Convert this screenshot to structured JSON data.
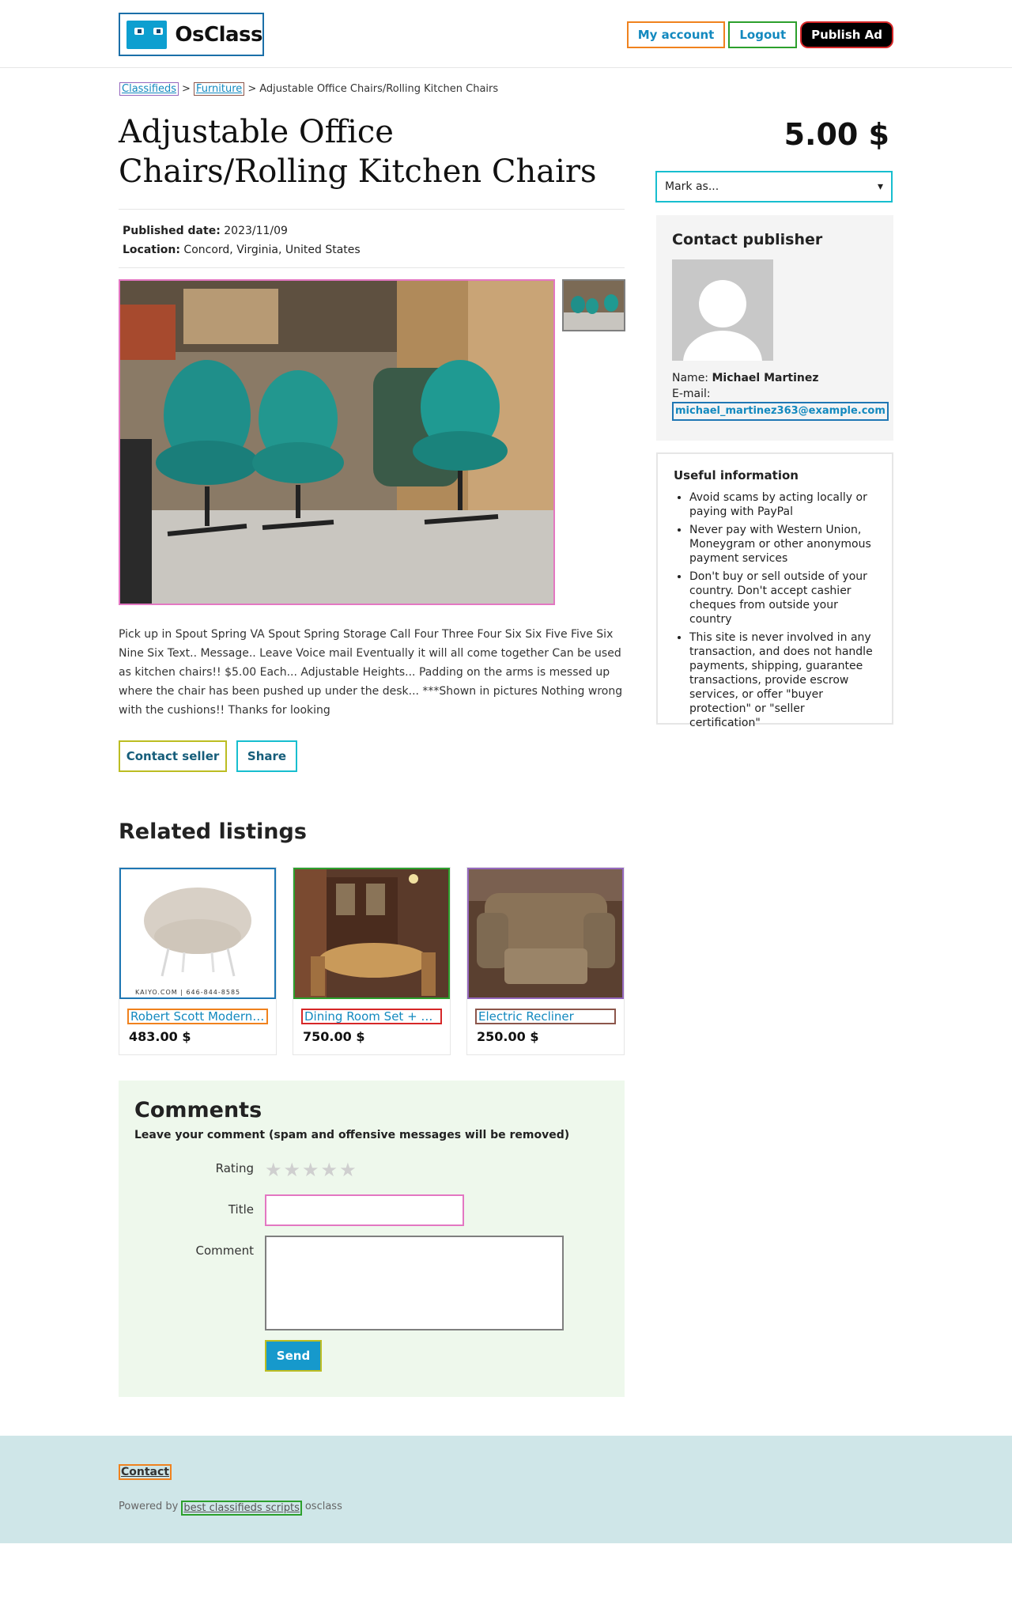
{
  "header": {
    "logo_text": "OsClass",
    "nav": {
      "my_account": "My account",
      "logout": "Logout",
      "publish": "Publish Ad"
    }
  },
  "breadcrumb": {
    "items": [
      "Classifieds",
      "Furniture"
    ],
    "current": "Adjustable Office Chairs/Rolling Kitchen Chairs",
    "separator": ">"
  },
  "listing": {
    "title": "Adjustable Office Chairs/Rolling Kitchen Chairs",
    "price": "5.00 $",
    "published_label": "Published date:",
    "published_value": "2023/11/09",
    "location_label": "Location:",
    "location_value": "Concord, Virginia, United States",
    "description": "Pick up in Spout Spring VA Spout Spring Storage Call Four Three Four Six Six Five Five Six Nine Six Text.. Message.. Leave Voice mail Eventually it will all come together Can be used as kitchen chairs!! $5.00 Each... Adjustable Heights... Padding on the arms is messed up where the chair has been pushed up under the desk... ***Shown in pictures Nothing wrong with the cushions!! Thanks for looking",
    "contact_button": "Contact seller",
    "share_button": "Share"
  },
  "aside": {
    "mark_as": "Mark as...",
    "contact_title": "Contact publisher",
    "name_label": "Name:",
    "name_value": "Michael Martinez",
    "email_label": "E-mail:",
    "email_value": "michael_martinez363@example.com",
    "useful_title": "Useful information",
    "useful_items": [
      "Avoid scams by acting locally or paying with PayPal",
      "Never pay with Western Union, Moneygram or other anonymous payment services",
      "Don't buy or sell outside of your country. Don't accept cashier cheques from outside your country",
      "This site is never involved in any transaction, and does not handle payments, shipping, guarantee transactions, provide escrow services, or offer \"buyer protection\" or \"seller certification\""
    ]
  },
  "related": {
    "title": "Related listings",
    "items": [
      {
        "name": "Robert Scott Modern Chair",
        "price": "483.00 $",
        "watermark": "KAIYO.COM | 646-844-8585"
      },
      {
        "name": "Dining Room Set + Hutch",
        "price": "750.00 $"
      },
      {
        "name": "Electric Recliner",
        "price": "250.00 $"
      }
    ]
  },
  "comments": {
    "title": "Comments",
    "note": "Leave your comment (spam and offensive messages will be removed)",
    "rating_label": "Rating",
    "title_label": "Title",
    "comment_label": "Comment",
    "send": "Send"
  },
  "footer": {
    "contact": "Contact",
    "powered_by": "Powered by",
    "link": "best classifieds scripts",
    "suffix": "osclass"
  },
  "colors": {
    "accent": "#1389bf",
    "send": "#1699cc",
    "comments_bg": "#eef8ec",
    "footer_bg": "#cfe6e8"
  }
}
